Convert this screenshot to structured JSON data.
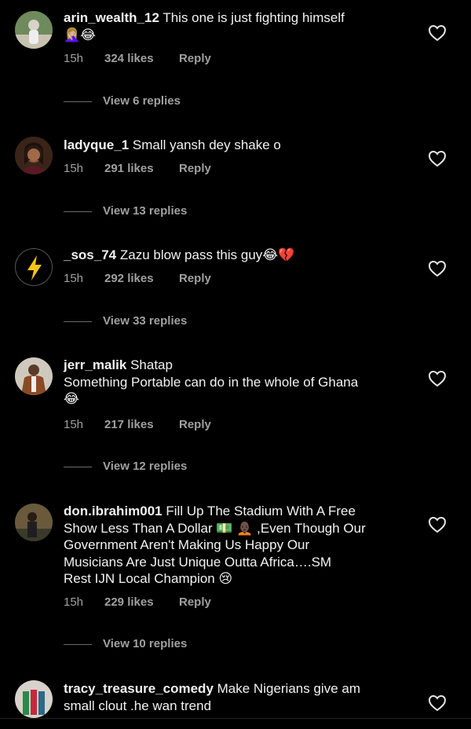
{
  "comments": [
    {
      "user": "arin_wealth_12",
      "text": "This one is just fighting himself",
      "emoji": "🤦🏼‍♀️😂",
      "time": "15h",
      "likes": "324 likes",
      "reply": "Reply",
      "view_replies": "View 6 replies"
    },
    {
      "user": "ladyque_1",
      "text": "Small yansh dey shake o",
      "emoji": "",
      "time": "15h",
      "likes": "291 likes",
      "reply": "Reply",
      "view_replies": "View 13 replies"
    },
    {
      "user": "_sos_74",
      "text": "Zazu blow pass this guy",
      "emoji": "😂💔",
      "time": "15h",
      "likes": "292 likes",
      "reply": "Reply",
      "view_replies": "View 33 replies"
    },
    {
      "user": "jerr_malik",
      "text": "Shatap",
      "text2": "Something Portable can do in the whole of Ghana",
      "emoji": "😂",
      "time": "15h",
      "likes": "217 likes",
      "reply": "Reply",
      "view_replies": "View 12 replies"
    },
    {
      "user": "don.ibrahim001",
      "text": "Fill Up The Stadium With A Free",
      "line2": "Show Less Than A Dollar 💵 🧑🏿‍🦲 ,Even Though Our",
      "line3": "Government Aren't Making Us Happy Our",
      "line4": "Musicians Are Just Unique Outta Africa….SM",
      "line5": "Rest IJN Local Champion 😢",
      "time": "15h",
      "likes": "229 likes",
      "reply": "Reply",
      "view_replies": "View 10 replies"
    },
    {
      "user": "tracy_treasure_comedy",
      "text": "Make Nigerians give am",
      "line2": "small clout .he wan trend"
    }
  ],
  "icons": {
    "heart": "heart-outline-icon",
    "bolt": "lightning-bolt-icon"
  },
  "colors": {
    "background": "#000000",
    "text": "#f2f2f2",
    "meta": "#a0a0a0",
    "bolt": "#f5c518"
  }
}
